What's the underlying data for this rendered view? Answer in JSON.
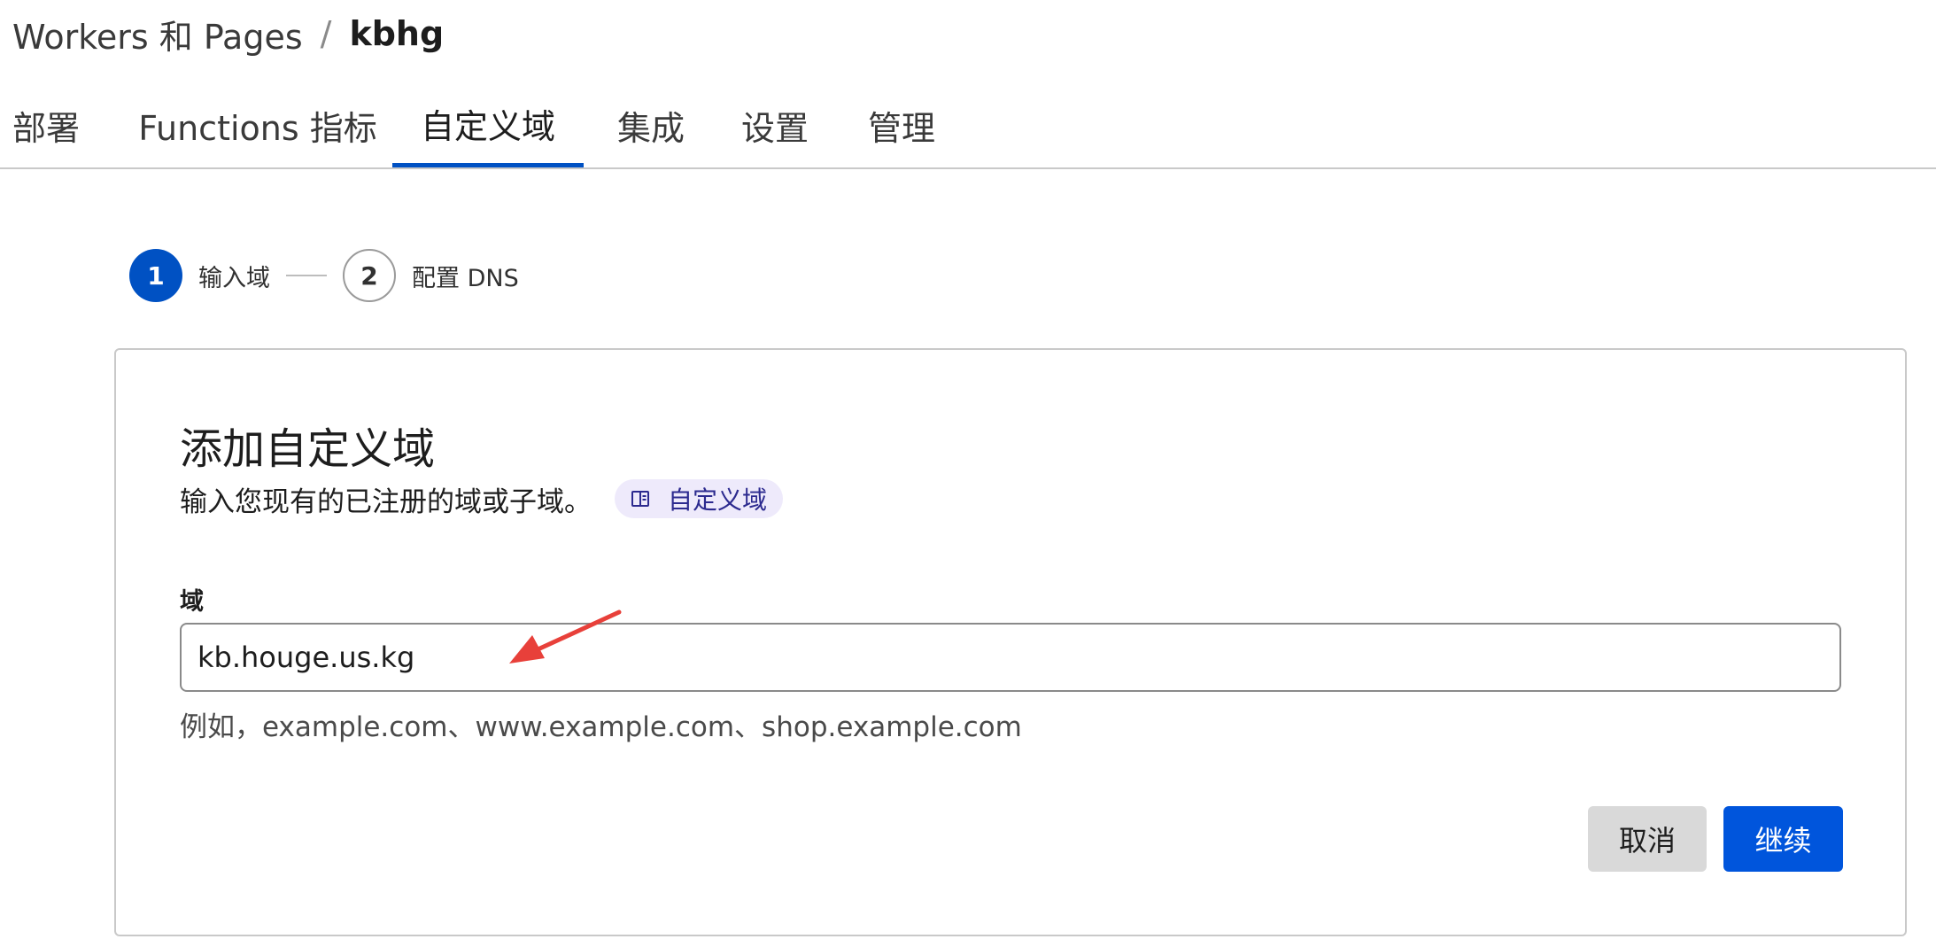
{
  "breadcrumb": {
    "parent": "Workers 和 Pages",
    "separator": "/",
    "current": "kbhg"
  },
  "tabs": [
    {
      "label": "部署"
    },
    {
      "label": "Functions 指标"
    },
    {
      "label": "自定义域"
    },
    {
      "label": "集成"
    },
    {
      "label": "设置"
    },
    {
      "label": "管理"
    }
  ],
  "active_tab": "自定义域",
  "stepper": {
    "steps": [
      {
        "number": "1",
        "label": "输入域",
        "active": true
      },
      {
        "number": "2",
        "label": "配置 DNS",
        "active": false
      }
    ]
  },
  "card": {
    "title": "添加自定义域",
    "subtitle": "输入您现有的已注册的域或子域。",
    "doc_chip": {
      "icon": "book-icon",
      "label": "自定义域"
    },
    "field": {
      "label": "域",
      "value": "kb.houge.us.kg",
      "hint": "例如，example.com、www.example.com、shop.example.com"
    },
    "buttons": {
      "cancel": "取消",
      "continue": "继续"
    }
  },
  "annotation": {
    "icon": "red-arrow-annotation",
    "color": "#e8403a"
  },
  "colors": {
    "accent": "#0051c3",
    "primary_button": "#0055dc",
    "chip_bg": "#eeeafb",
    "chip_text": "#2c2a8f"
  }
}
